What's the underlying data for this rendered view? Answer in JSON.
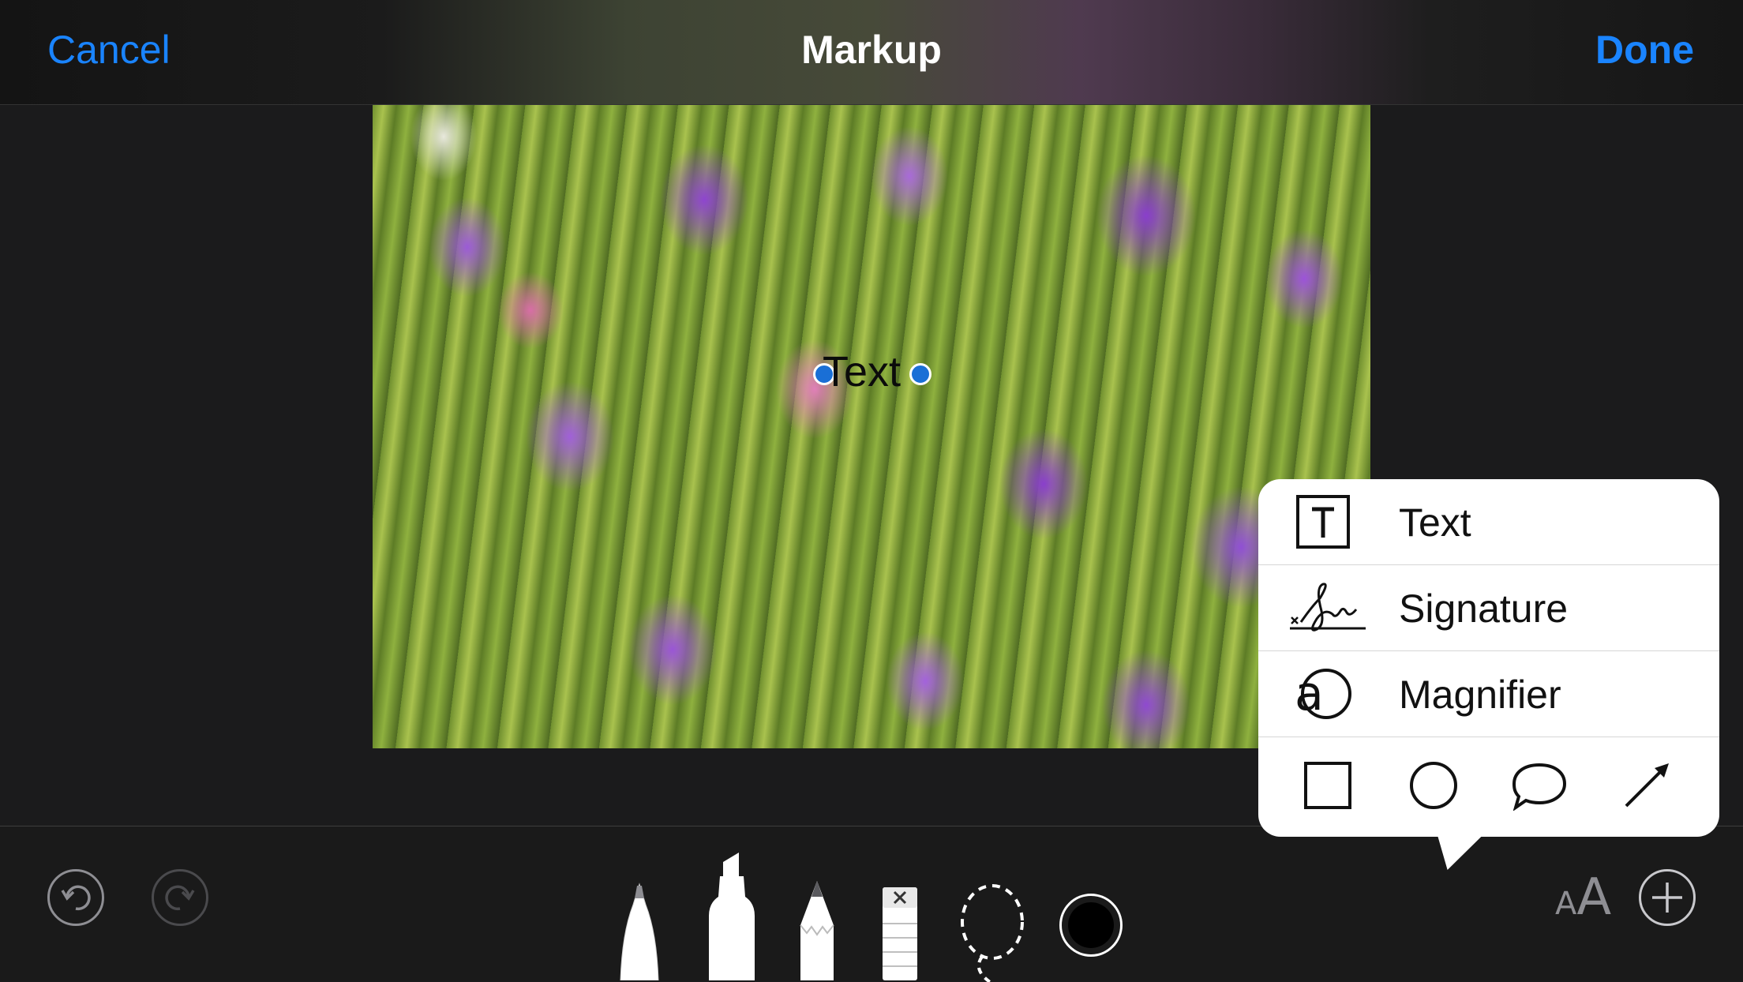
{
  "nav": {
    "cancel_label": "Cancel",
    "title": "Markup",
    "done_label": "Done",
    "accent": "#1a84ff"
  },
  "canvas": {
    "text_annotation": "Text"
  },
  "popover": {
    "items": [
      {
        "label": "Text",
        "icon": "text-box-icon"
      },
      {
        "label": "Signature",
        "icon": "signature-icon"
      },
      {
        "label": "Magnifier",
        "icon": "magnifier-icon"
      }
    ],
    "shapes": [
      "rectangle-icon",
      "oval-icon",
      "speech-bubble-icon",
      "arrow-icon"
    ]
  },
  "toolbar": {
    "undo_icon": "undo-icon",
    "redo_icon": "redo-icon",
    "tools": [
      "pen-icon",
      "highlighter-icon",
      "pencil-icon",
      "eraser-icon",
      "lasso-icon",
      "color-picker-icon"
    ],
    "text_size_small": "A",
    "text_size_large": "A",
    "add_icon": "plus-icon",
    "selected_color": "#000000"
  }
}
